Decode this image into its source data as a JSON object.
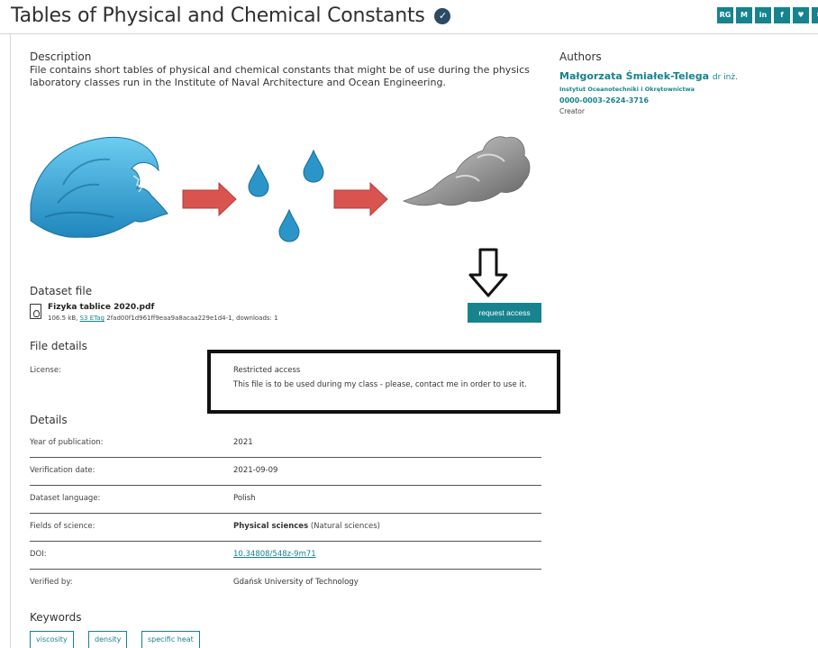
{
  "header": {
    "title": "Tables of Physical and Chemical Constants",
    "verified_icon": "check-circle-icon",
    "social_buttons": [
      "RG",
      "M",
      "in",
      "f",
      "♥",
      "✉"
    ]
  },
  "description": {
    "heading": "Description",
    "text": "File contains short tables of physical and chemical constants that might be of use during the physics laboratory classes run in the Institute of Naval Architecture and Ocean Engineering."
  },
  "authors": {
    "heading": "Authors",
    "name": "Małgorzata Śmiałek-Telega",
    "degree": "dr inż.",
    "affiliation": "Instytut Oceanotechniki i Okrętownictwa",
    "orcid": "0000-0003-2624-3716",
    "role": "Creator"
  },
  "dataset_file": {
    "heading": "Dataset file",
    "name": "Fizyka tablice 2020.pdf",
    "size": "106.5 kB,",
    "s3_label": "S3 ETag",
    "etag": "2fad00f1d961ff9eaa9a8acaa229e1d4-1,",
    "downloads": "downloads: 1",
    "request_button": "request access"
  },
  "file_details": {
    "heading": "File details",
    "license_label": "License:",
    "license_value": "Restricted access",
    "license_note": "This file is to be used during my class - please, contact me in order to use it."
  },
  "details": {
    "heading": "Details",
    "rows": [
      {
        "label": "Year of publication:",
        "value": "2021"
      },
      {
        "label": "Verification date:",
        "value": "2021-09-09"
      },
      {
        "label": "Dataset language:",
        "value": "Polish"
      },
      {
        "label": "Fields of science:",
        "value": "Physical sciences",
        "sub": "(Natural sciences)"
      },
      {
        "label": "DOI:",
        "value": "10.34808/548z-9m71"
      },
      {
        "label": "Verified by:",
        "value": "Gdańsk University of Technology"
      }
    ]
  },
  "keywords": {
    "heading": "Keywords",
    "items": [
      "viscosity",
      "density",
      "specific heat"
    ]
  },
  "colors": {
    "accent": "#16838e",
    "arrow": "#d9534f",
    "water": "#2b95c9"
  }
}
